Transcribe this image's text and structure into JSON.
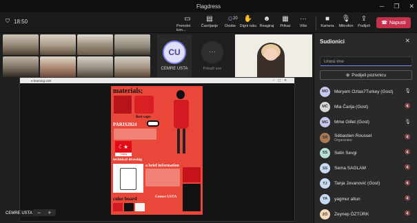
{
  "window": {
    "title": "Flagdress"
  },
  "toolbar": {
    "timer": "18:50",
    "items": [
      {
        "label": "Prenotni kon..."
      },
      {
        "label": "Čavrljanje"
      },
      {
        "label": "Osobe",
        "count": "20"
      },
      {
        "label": "Digni ruku"
      },
      {
        "label": "Reagiraj"
      },
      {
        "label": "Prikaz"
      },
      {
        "label": "Više"
      },
      {
        "label": "Kamera"
      },
      {
        "label": "Mikrofon"
      },
      {
        "label": "Podijeli"
      }
    ],
    "leave_label": "Napusti"
  },
  "stage": {
    "avatar_initials": "CU",
    "avatar_name": "CEMRE USTA",
    "more_label": "Prikaži sve",
    "presenter_chip": "CEMRE USTA",
    "share_window_title": "e-learning-LMI",
    "slide": {
      "heading": "materials;",
      "label_redcape": "Red cape",
      "label_paris": "PARIS2024",
      "label_flag": "Turkey",
      "label_technical": "technical drawing",
      "label_brief": "a brief information",
      "label_colorboard": "color board",
      "label_author": "Cemre USTA"
    }
  },
  "panel": {
    "title": "Sudionici",
    "search_placeholder": "Unesi ime",
    "invite_label": "Podijeli pozivnicu",
    "participants": [
      {
        "initials": "MO",
        "name": "Meryem Oztas7Turkey (Gost)",
        "role": "",
        "avatar_color": "#c6c8f0",
        "mic": "on"
      },
      {
        "initials": "MČ",
        "name": "Mia Čarija (Gost)",
        "role": "",
        "avatar_color": "#d8d8d8",
        "mic": "off"
      },
      {
        "initials": "MG",
        "name": "Mme Gillet (Gost)",
        "role": "",
        "avatar_color": "#c6c8f0",
        "mic": "on"
      },
      {
        "initials": "SR",
        "name": "Sébastien Roussel",
        "role": "Organizator",
        "avatar_color": "#a77a55",
        "mic": "off"
      },
      {
        "initials": "SS",
        "name": "Selin Sevgi",
        "role": "",
        "avatar_color": "#b6e0d6",
        "mic": "off"
      },
      {
        "initials": "SS",
        "name": "Sema SAGLAM",
        "role": "",
        "avatar_color": "#c9dbf2",
        "mic": "off"
      },
      {
        "initials": "TJ",
        "name": "Tanja Jovanović (Gost)",
        "role": "",
        "avatar_color": "#c9dbf2",
        "mic": "off"
      },
      {
        "initials": "YA",
        "name": "yagmur altun",
        "role": "",
        "avatar_color": "#c9dbf2",
        "mic": "off"
      },
      {
        "initials": "ZÖ",
        "name": "Zeynep ÖZTÜRK",
        "role": "",
        "avatar_color": "#f4d9b8",
        "mic": "off"
      }
    ]
  },
  "colors": {
    "accent": "#7f85f5",
    "leave": "#c4314b",
    "slide_red": "#e8473a"
  }
}
